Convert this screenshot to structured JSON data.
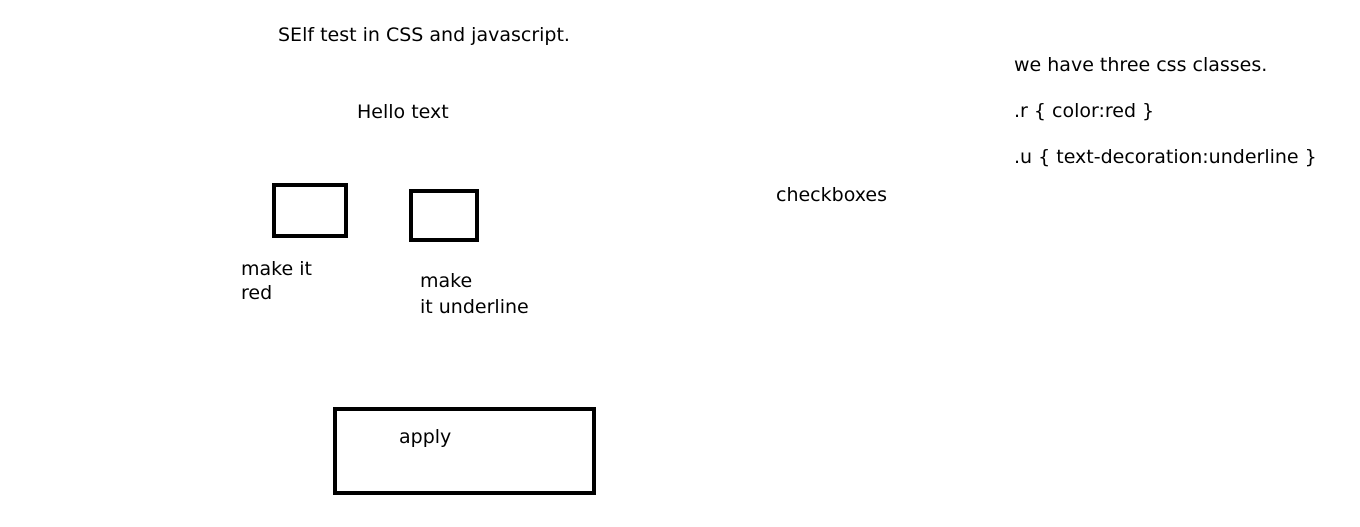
{
  "header": {
    "title": "SElf test in CSS and javascript."
  },
  "preview": {
    "text": "Hello text"
  },
  "options": [
    {
      "label_lines": [
        "make it",
        "red"
      ]
    },
    {
      "label_lines": [
        "make",
        "it underline"
      ]
    }
  ],
  "apply_button": {
    "label": "apply"
  },
  "notes": {
    "checkboxes_label": "checkboxes",
    "intro": "we have three css classes.",
    "class_r": ".r  { color:red  }",
    "class_u": ".u  { text-decoration:underline }"
  }
}
